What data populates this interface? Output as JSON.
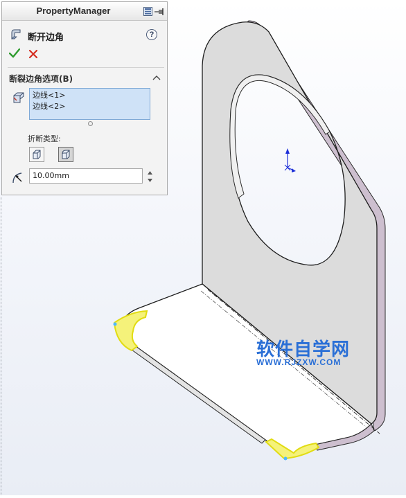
{
  "property_manager": {
    "title": "PropertyManager",
    "feature_title": "断开边角",
    "help_label": "?",
    "section": {
      "title": "断裂边角选项(B)",
      "edges": [
        "边线<1>",
        "边线<2>"
      ],
      "break_type_label": "折断类型:",
      "break_types": [
        {
          "name": "chamfer",
          "selected": false
        },
        {
          "name": "fillet",
          "selected": true
        }
      ],
      "distance_value": "10.00mm"
    }
  },
  "icons": {
    "ok": "checkmark-icon",
    "cancel": "close-icon",
    "help": "help-icon",
    "pin": "pin-icon",
    "layout": "layout-icon",
    "collapse": "chevron-up-icon"
  },
  "colors": {
    "ok": "#2e9b2e",
    "cancel": "#d42b1e",
    "selection": "#cfe2f7",
    "highlight_edge": "#f2f020",
    "watermark": "#2a6fd6"
  },
  "watermark": {
    "text": "软件自学网",
    "url": "WWW.RJZXW.COM"
  }
}
